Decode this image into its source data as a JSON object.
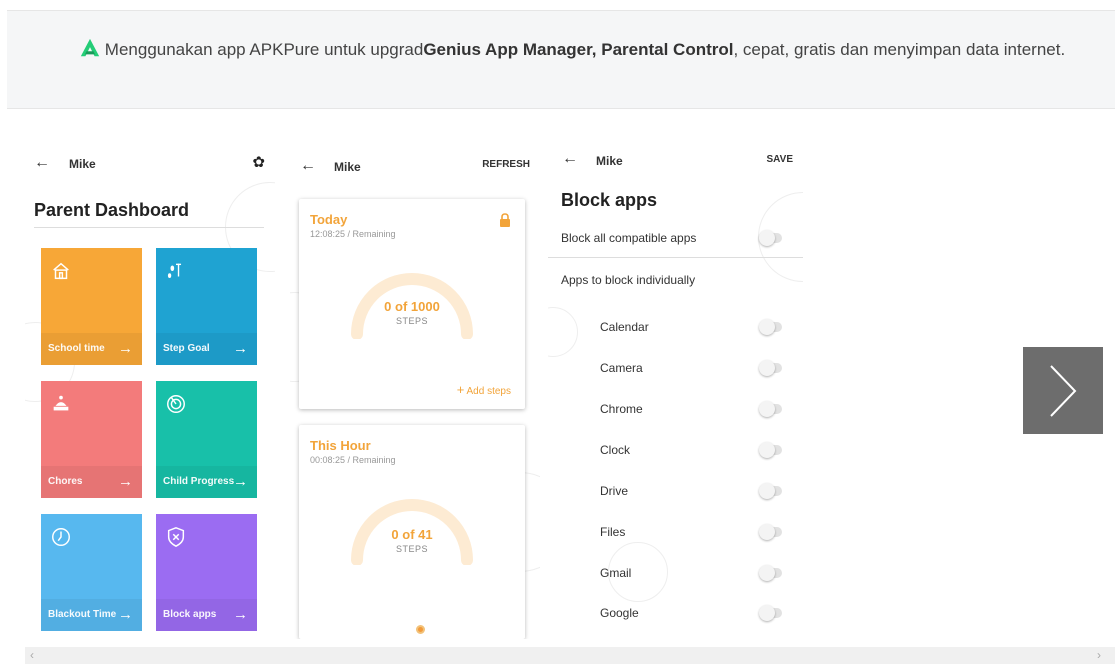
{
  "banner": {
    "text_prefix": "Menggunakan app APKPure untuk upgrad",
    "app_name": "Genius App Manager, Parental Control",
    "text_suffix": ", cepat, gratis dan menyimpan data internet.",
    "logo_icon": "apkpure-logo-icon",
    "logo_color": "#24cd77"
  },
  "screen1": {
    "user": "Mike",
    "title": "Parent Dashboard",
    "tiles": [
      {
        "label": "School time",
        "icon": "school-icon",
        "color": "#f7a737"
      },
      {
        "label": "Step Goal",
        "icon": "footsteps-icon",
        "color": "#1fa3d2"
      },
      {
        "label": "Chores",
        "icon": "chores-icon",
        "color": "#f37b7b"
      },
      {
        "label": "Child Progress",
        "icon": "progress-icon",
        "color": "#18c0a9"
      },
      {
        "label": "Blackout Time",
        "icon": "clock-icon",
        "color": "#57b8ef"
      },
      {
        "label": "Block apps",
        "icon": "shield-icon",
        "color": "#9b6cf2"
      }
    ]
  },
  "screen2": {
    "user": "Mike",
    "refresh": "REFRESH",
    "today": {
      "title": "Today",
      "subtitle": "12:08:25 / Remaining",
      "value": "0 of 1000",
      "unit": "STEPS",
      "add": "Add steps"
    },
    "hour": {
      "title": "This Hour",
      "subtitle": "00:08:25 / Remaining",
      "value": "0 of 41",
      "unit": "STEPS"
    }
  },
  "screen3": {
    "user": "Mike",
    "save": "SAVE",
    "title": "Block apps",
    "block_all": "Block all compatible apps",
    "individual_header": "Apps to block individually",
    "apps": [
      "Calendar",
      "Camera",
      "Chrome",
      "Clock",
      "Drive",
      "Files",
      "Gmail",
      "Google"
    ]
  }
}
